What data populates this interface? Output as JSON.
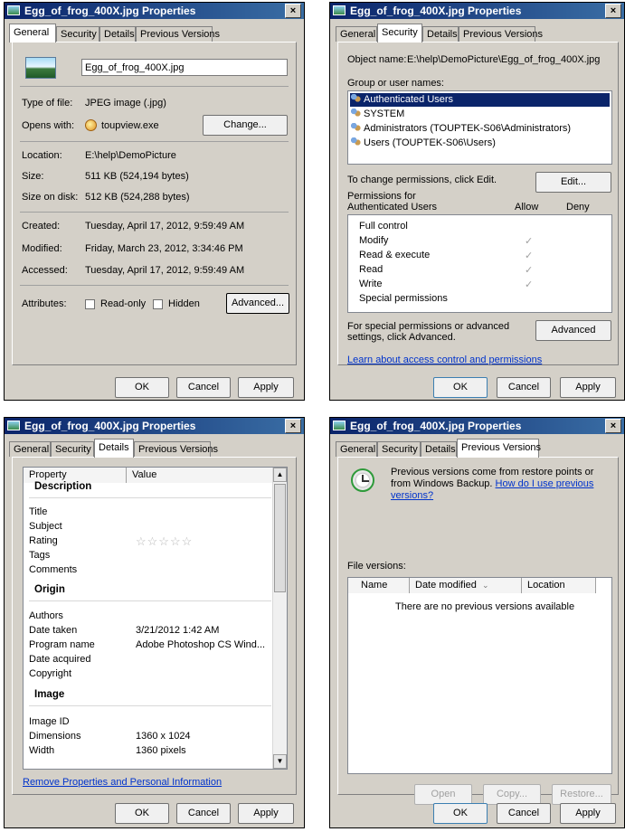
{
  "title": "Egg_of_frog_400X.jpg Properties",
  "close_glyph": "×",
  "tabs": {
    "general": "General",
    "security": "Security",
    "details": "Details",
    "previous": "Previous Versions"
  },
  "buttons": {
    "ok": "OK",
    "cancel": "Cancel",
    "apply": "Apply"
  },
  "general": {
    "filename": "Egg_of_frog_400X.jpg",
    "type_label": "Type of file:",
    "type_value": "JPEG image (.jpg)",
    "opens_label": "Opens with:",
    "opens_value": "toupview.exe",
    "change_btn": "Change...",
    "location_label": "Location:",
    "location_value": "E:\\help\\DemoPicture",
    "size_label": "Size:",
    "size_value": "511 KB (524,194 bytes)",
    "disk_label": "Size on disk:",
    "disk_value": "512 KB (524,288 bytes)",
    "created_label": "Created:",
    "created_value": "Tuesday, April 17, 2012, 9:59:49 AM",
    "modified_label": "Modified:",
    "modified_value": "Friday, March 23, 2012, 3:34:46 PM",
    "accessed_label": "Accessed:",
    "accessed_value": "Tuesday, April 17, 2012, 9:59:49 AM",
    "attributes_label": "Attributes:",
    "readonly_label": "Read-only",
    "hidden_label": "Hidden",
    "advanced_btn": "Advanced..."
  },
  "security": {
    "object_label": "Object name:",
    "object_value": "E:\\help\\DemoPicture\\Egg_of_frog_400X.jpg",
    "groups_label": "Group or user names:",
    "groups": [
      "Authenticated Users",
      "SYSTEM",
      "Administrators (TOUPTEK-S06\\Administrators)",
      "Users (TOUPTEK-S06\\Users)"
    ],
    "change_text": "To change permissions, click Edit.",
    "edit_btn": "Edit...",
    "perm_label": "Permissions for Authenticated Users",
    "allow": "Allow",
    "deny": "Deny",
    "permissions": [
      {
        "name": "Full control",
        "allow": ""
      },
      {
        "name": "Modify",
        "allow": "✓"
      },
      {
        "name": "Read & execute",
        "allow": "✓"
      },
      {
        "name": "Read",
        "allow": "✓"
      },
      {
        "name": "Write",
        "allow": "✓"
      },
      {
        "name": "Special permissions",
        "allow": ""
      }
    ],
    "special_text": "For special permissions or advanced settings, click Advanced.",
    "advanced_btn": "Advanced",
    "learn_link": "Learn about access control and permissions"
  },
  "details": {
    "col_property": "Property",
    "col_value": "Value",
    "groups": {
      "description": "Description",
      "origin": "Origin",
      "image": "Image"
    },
    "description_rows": [
      {
        "p": "Title",
        "v": ""
      },
      {
        "p": "Subject",
        "v": ""
      },
      {
        "p": "Rating",
        "v": "☆☆☆☆☆"
      },
      {
        "p": "Tags",
        "v": ""
      },
      {
        "p": "Comments",
        "v": ""
      }
    ],
    "origin_rows": [
      {
        "p": "Authors",
        "v": ""
      },
      {
        "p": "Date taken",
        "v": "3/21/2012 1:42 AM"
      },
      {
        "p": "Program name",
        "v": "Adobe Photoshop CS Wind..."
      },
      {
        "p": "Date acquired",
        "v": ""
      },
      {
        "p": "Copyright",
        "v": ""
      }
    ],
    "image_rows": [
      {
        "p": "Image ID",
        "v": ""
      },
      {
        "p": "Dimensions",
        "v": "1360 x 1024"
      },
      {
        "p": "Width",
        "v": "1360 pixels"
      }
    ],
    "remove_link": "Remove Properties and Personal Information"
  },
  "previous": {
    "info_text": "Previous versions come from restore points or from Windows Backup.",
    "info_link": "How do I use previous versions?",
    "versions_label": "File versions:",
    "col_name": "Name",
    "col_date": "Date modified",
    "col_location": "Location",
    "empty": "There are no previous versions available",
    "open_btn": "Open",
    "copy_btn": "Copy...",
    "restore_btn": "Restore..."
  }
}
